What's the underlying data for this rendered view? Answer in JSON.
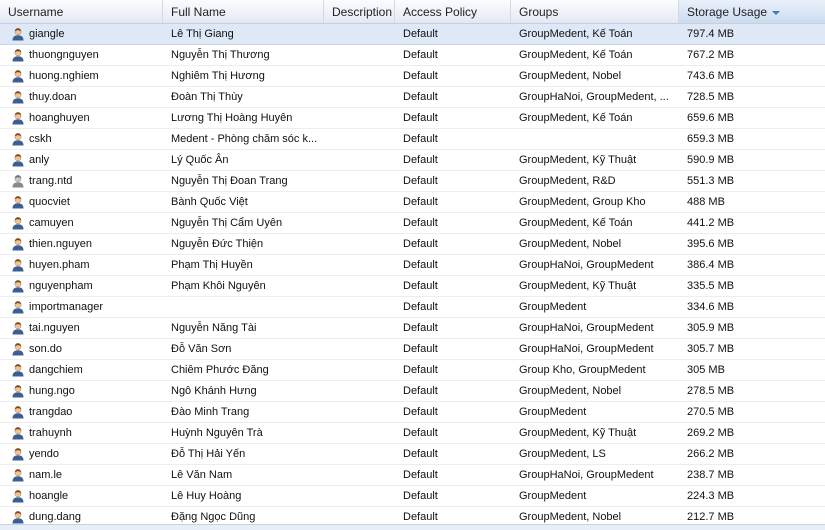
{
  "columns": {
    "username": "Username",
    "full_name": "Full Name",
    "description": "Description",
    "access_policy": "Access Policy",
    "groups": "Groups",
    "storage_usage": "Storage Usage"
  },
  "sorted_column": "storage_usage",
  "sort_direction": "descending",
  "colors": {
    "header_bg": "#e3e9f3",
    "selected_row": "#dfe8f6",
    "sort_arrow": "#4a77b4"
  },
  "rows": [
    {
      "username": "giangle",
      "full_name": "Lê Thị Giang",
      "description": "",
      "policy": "Default",
      "groups": "GroupMedent, Kế Toán",
      "storage": "797.4 MB",
      "icon": "user-icon"
    },
    {
      "username": "thuongnguyen",
      "full_name": "Nguyễn Thị Thương",
      "description": "",
      "policy": "Default",
      "groups": "GroupMedent, Kế Toán",
      "storage": "767.2 MB",
      "icon": "user-icon"
    },
    {
      "username": "huong.nghiem",
      "full_name": "Nghiêm Thị Hương",
      "description": "",
      "policy": "Default",
      "groups": "GroupMedent, Nobel",
      "storage": "743.6 MB",
      "icon": "user-icon"
    },
    {
      "username": "thuy.doan",
      "full_name": "Đoàn Thị Thùy",
      "description": "",
      "policy": "Default",
      "groups": "GroupHaNoi, GroupMedent, ...",
      "storage": "728.5 MB",
      "icon": "user-icon"
    },
    {
      "username": "hoanghuyen",
      "full_name": "Lương Thị Hoàng Huyên",
      "description": "",
      "policy": "Default",
      "groups": "GroupMedent, Kế Toán",
      "storage": "659.6 MB",
      "icon": "user-icon"
    },
    {
      "username": "cskh",
      "full_name": "Medent - Phòng chăm sóc k...",
      "description": "",
      "policy": "Default",
      "groups": "",
      "storage": "659.3 MB",
      "icon": "user-icon"
    },
    {
      "username": "anly",
      "full_name": "Lý Quốc Ân",
      "description": "",
      "policy": "Default",
      "groups": "GroupMedent, Kỹ Thuật",
      "storage": "590.9 MB",
      "icon": "user-icon"
    },
    {
      "username": "trang.ntd",
      "full_name": "Nguyễn Thị Đoan Trang",
      "description": "",
      "policy": "Default",
      "groups": "GroupMedent, R&D",
      "storage": "551.3 MB",
      "icon": "user-icon-gray"
    },
    {
      "username": "quocviet",
      "full_name": "Bành Quốc Việt",
      "description": "",
      "policy": "Default",
      "groups": "GroupMedent, Group Kho",
      "storage": "488 MB",
      "icon": "user-icon"
    },
    {
      "username": "camuyen",
      "full_name": "Nguyễn Thị Cẩm Uyên",
      "description": "",
      "policy": "Default",
      "groups": "GroupMedent, Kế Toán",
      "storage": "441.2 MB",
      "icon": "user-icon"
    },
    {
      "username": "thien.nguyen",
      "full_name": "Nguyễn Đức Thiện",
      "description": "",
      "policy": "Default",
      "groups": "GroupMedent, Nobel",
      "storage": "395.6 MB",
      "icon": "user-icon"
    },
    {
      "username": "huyen.pham",
      "full_name": "Phạm Thị Huyền",
      "description": "",
      "policy": "Default",
      "groups": "GroupHaNoi, GroupMedent",
      "storage": "386.4 MB",
      "icon": "user-icon"
    },
    {
      "username": "nguyenpham",
      "full_name": "Phạm Khôi Nguyên",
      "description": "",
      "policy": "Default",
      "groups": "GroupMedent, Kỹ Thuật",
      "storage": "335.5 MB",
      "icon": "user-icon"
    },
    {
      "username": "importmanager",
      "full_name": "",
      "description": "",
      "policy": "Default",
      "groups": "GroupMedent",
      "storage": "334.6 MB",
      "icon": "user-icon"
    },
    {
      "username": "tai.nguyen",
      "full_name": "Nguyễn Năng Tài",
      "description": "",
      "policy": "Default",
      "groups": "GroupHaNoi, GroupMedent",
      "storage": "305.9 MB",
      "icon": "user-icon"
    },
    {
      "username": "son.do",
      "full_name": "Đỗ Văn Sơn",
      "description": "",
      "policy": "Default",
      "groups": "GroupHaNoi, GroupMedent",
      "storage": "305.7 MB",
      "icon": "user-icon"
    },
    {
      "username": "dangchiem",
      "full_name": "Chiêm Phước Đăng",
      "description": "",
      "policy": "Default",
      "groups": "Group Kho, GroupMedent",
      "storage": "305 MB",
      "icon": "user-icon"
    },
    {
      "username": "hung.ngo",
      "full_name": "Ngô Khánh Hưng",
      "description": "",
      "policy": "Default",
      "groups": "GroupMedent, Nobel",
      "storage": "278.5 MB",
      "icon": "user-icon"
    },
    {
      "username": "trangdao",
      "full_name": "Đào Minh Trang",
      "description": "",
      "policy": "Default",
      "groups": "GroupMedent",
      "storage": "270.5 MB",
      "icon": "user-icon"
    },
    {
      "username": "trahuynh",
      "full_name": "Huỳnh Nguyên Trà",
      "description": "",
      "policy": "Default",
      "groups": "GroupMedent, Kỹ Thuật",
      "storage": "269.2 MB",
      "icon": "user-icon"
    },
    {
      "username": "yendo",
      "full_name": "Đỗ Thị Hải Yến",
      "description": "",
      "policy": "Default",
      "groups": "GroupMedent, LS",
      "storage": "266.2 MB",
      "icon": "user-icon"
    },
    {
      "username": "nam.le",
      "full_name": "Lê Văn Nam",
      "description": "",
      "policy": "Default",
      "groups": "GroupHaNoi, GroupMedent",
      "storage": "238.7 MB",
      "icon": "user-icon"
    },
    {
      "username": "hoangle",
      "full_name": "Lê Huy Hoàng",
      "description": "",
      "policy": "Default",
      "groups": "GroupMedent",
      "storage": "224.3 MB",
      "icon": "user-icon"
    },
    {
      "username": "dung.dang",
      "full_name": "Đặng Ngọc Dũng",
      "description": "",
      "policy": "Default",
      "groups": "GroupMedent, Nobel",
      "storage": "212.7 MB",
      "icon": "user-icon"
    }
  ]
}
